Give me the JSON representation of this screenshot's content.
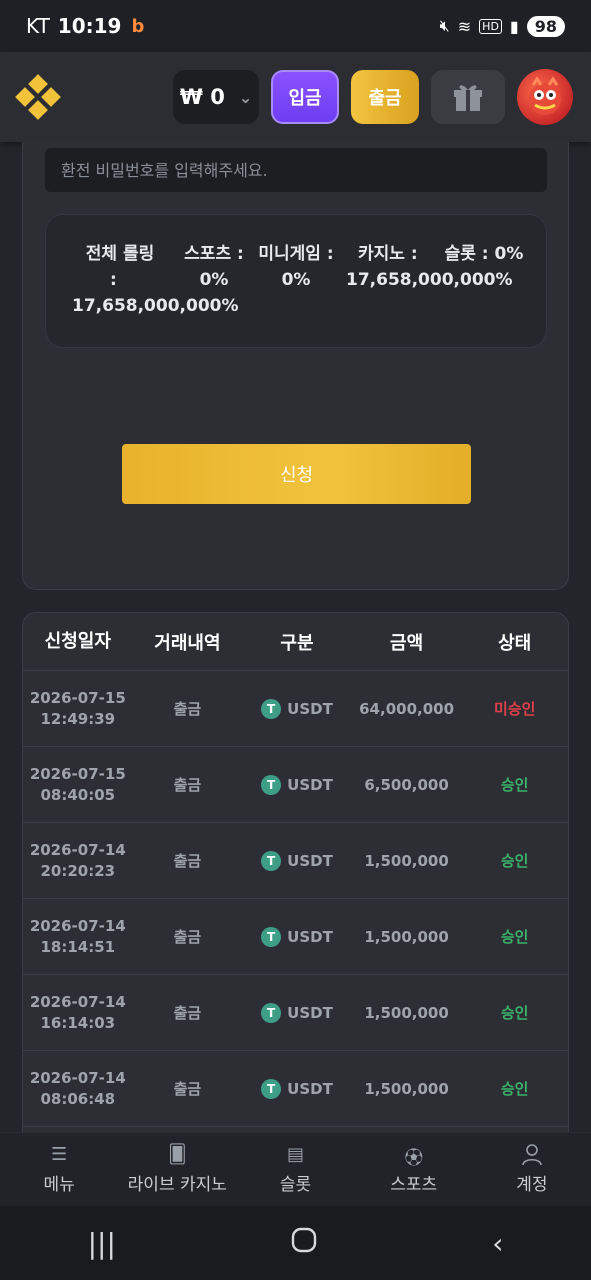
{
  "status_bar": {
    "carrier": "KT",
    "time": "10:19",
    "notification_icon": "b",
    "net_label": "HD",
    "battery": "98"
  },
  "header": {
    "balance": "₩ 0",
    "deposit_label": "입금",
    "withdraw_label": "출금",
    "colors": {
      "deposit": "#7a47f7",
      "withdraw": "#f0c03a"
    }
  },
  "form": {
    "password_placeholder": "환전 비밀번호를 입력해주세요.",
    "rolling": {
      "total_label": "전체 롤링",
      "total_colon": ":",
      "total_value": "17,658,000,000%",
      "sports_label": "스포츠 :",
      "sports_value": "0%",
      "mini_label": "미니게임 :",
      "mini_value": "0%",
      "casino_label": "카지노 :",
      "casino_value": "17,658,000,000%",
      "slot_label": "슬롯 : 0%"
    },
    "apply_label": "신청"
  },
  "table": {
    "headers": [
      "신청일자",
      "거래내역",
      "구분",
      "금액",
      "상태"
    ],
    "rows": [
      {
        "date": "2026-07-15",
        "time": "12:49:39",
        "type": "출금",
        "currency": "USDT",
        "amount": "64,000,000",
        "status": "미승인",
        "status_kind": "pending"
      },
      {
        "date": "2026-07-15",
        "time": "08:40:05",
        "type": "출금",
        "currency": "USDT",
        "amount": "6,500,000",
        "status": "승인",
        "status_kind": "ok"
      },
      {
        "date": "2026-07-14",
        "time": "20:20:23",
        "type": "출금",
        "currency": "USDT",
        "amount": "1,500,000",
        "status": "승인",
        "status_kind": "ok"
      },
      {
        "date": "2026-07-14",
        "time": "18:14:51",
        "type": "출금",
        "currency": "USDT",
        "amount": "1,500,000",
        "status": "승인",
        "status_kind": "ok"
      },
      {
        "date": "2026-07-14",
        "time": "16:14:03",
        "type": "출금",
        "currency": "USDT",
        "amount": "1,500,000",
        "status": "승인",
        "status_kind": "ok"
      },
      {
        "date": "2026-07-14",
        "time": "08:06:48",
        "type": "출금",
        "currency": "USDT",
        "amount": "1,500,000",
        "status": "승인",
        "status_kind": "ok"
      }
    ]
  },
  "bottom_nav": [
    {
      "label": "메뉴",
      "icon": "menu-icon"
    },
    {
      "label": "라이브 카지노",
      "icon": "cards-icon"
    },
    {
      "label": "슬롯",
      "icon": "slot-machine-icon"
    },
    {
      "label": "스포츠",
      "icon": "soccer-ball-icon"
    },
    {
      "label": "계정",
      "icon": "user-icon"
    }
  ]
}
